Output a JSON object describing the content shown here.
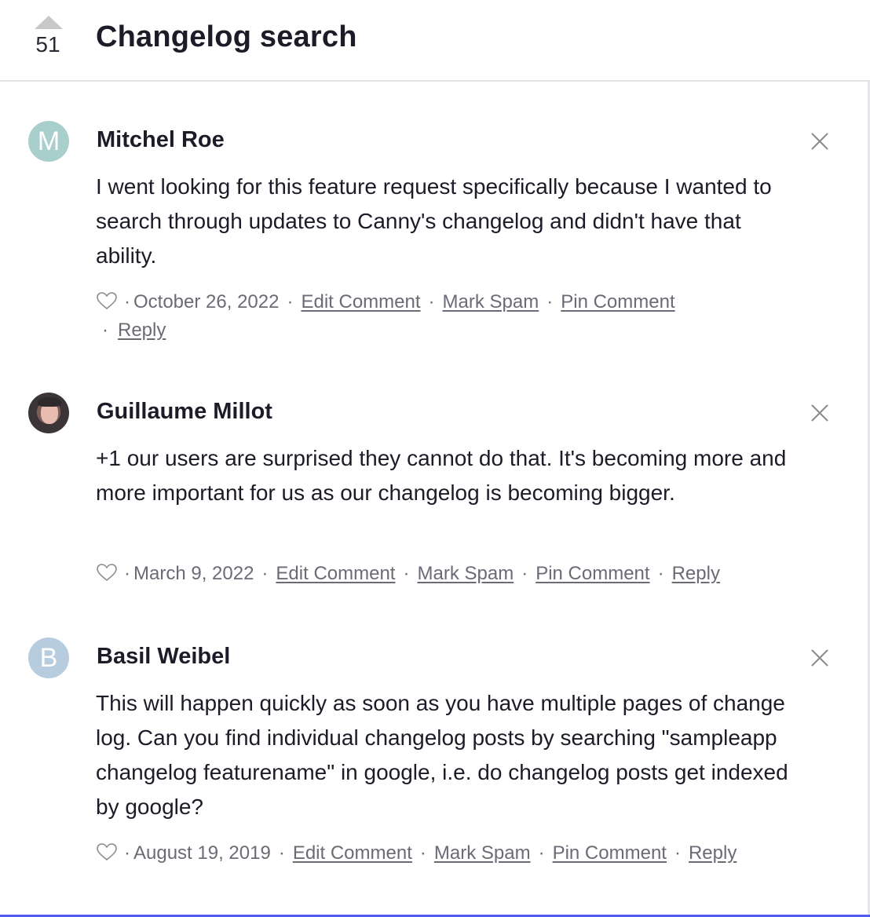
{
  "post": {
    "vote_count": "51",
    "title": "Changelog search"
  },
  "comments": [
    {
      "author": "Mitchel Roe",
      "avatar_initial": "M",
      "avatar_color": "#a9cfcd",
      "body": "I went looking for this feature request specifically because I wanted to search through updates to Canny's changelog and didn't have that ability.",
      "date": "October 26, 2022",
      "actions": {
        "edit": "Edit Comment",
        "spam": "Mark Spam",
        "pin": "Pin Comment",
        "reply": "Reply"
      }
    },
    {
      "author": "Guillaume Millot",
      "avatar_initial": "",
      "avatar_color": "#3b3538",
      "body": "+1 our users are surprised they cannot do that. It's becoming more and more important for us as our changelog is becoming bigger.",
      "date": "March 9, 2022",
      "actions": {
        "edit": "Edit Comment",
        "spam": "Mark Spam",
        "pin": "Pin Comment",
        "reply": "Reply"
      }
    },
    {
      "author": "Basil Weibel",
      "avatar_initial": "B",
      "avatar_color": "#b8cce0",
      "body": "This will happen quickly as soon as you have multiple pages of change log. Can you find individual changelog posts by searching \"sampleapp changelog featurename\" in google, i.e. do changelog posts get indexed by google?",
      "date": "August 19, 2019",
      "actions": {
        "edit": "Edit Comment",
        "spam": "Mark Spam",
        "pin": "Pin Comment",
        "reply": "Reply"
      }
    }
  ],
  "separator": "·",
  "icons": {
    "upvote": "upvote-arrow-icon",
    "like": "heart-icon",
    "delete": "close-icon"
  },
  "colors": {
    "accent": "#525df4",
    "text": "#1c1c28",
    "muted": "#6b6b76",
    "border": "#e4e4e6"
  }
}
